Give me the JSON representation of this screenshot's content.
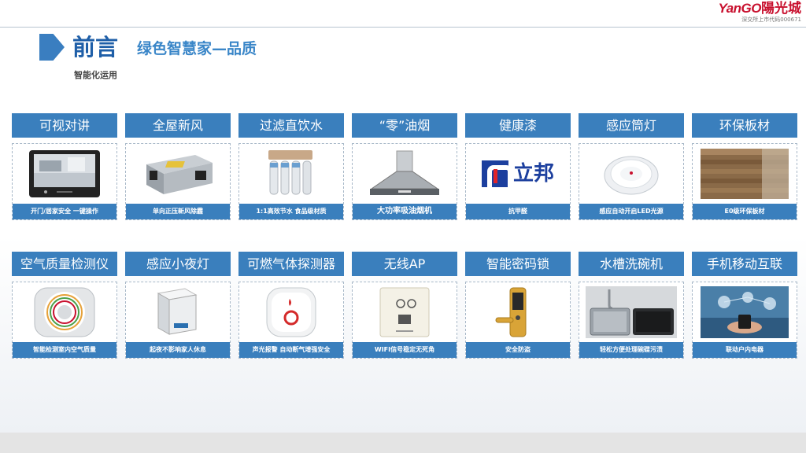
{
  "header": {
    "logo_en": "YanGO",
    "logo_cn": "陽光城",
    "logo_sub": "深交所上市代码000671"
  },
  "title": {
    "main": "前言",
    "sub": "绿色智慧家—品质",
    "section": "智能化运用"
  },
  "colors": {
    "accent": "#3a7fbd",
    "title": "#1f5fa8",
    "brand_red": "#c8102e"
  },
  "row1": [
    {
      "title": "可视对讲",
      "caption": "开门/居家安全  一键操作",
      "icon": "video-intercom-icon"
    },
    {
      "title": "全屋新风",
      "caption": "单向正压新风除霾",
      "icon": "fresh-air-unit-icon"
    },
    {
      "title": "过滤直饮水",
      "caption": "1:1高效节水  食品级材质",
      "icon": "water-filter-icon"
    },
    {
      "title": "“零”油烟",
      "caption": "大功率吸油烟机",
      "icon": "range-hood-icon"
    },
    {
      "title": "健康漆",
      "caption": "抗甲醛",
      "icon": "nippon-logo-icon",
      "brand": "立邦"
    },
    {
      "title": "感应筒灯",
      "caption": "感应自动开启LED光源",
      "icon": "downlight-icon"
    },
    {
      "title": "环保板材",
      "caption": "E0级环保板材",
      "icon": "wood-panel-icon"
    }
  ],
  "row2": [
    {
      "title": "空气质量检测仪",
      "caption": "智能检测室内空气质量",
      "icon": "air-monitor-icon"
    },
    {
      "title": "感应小夜灯",
      "caption": "起夜不影响家人休息",
      "icon": "night-light-icon"
    },
    {
      "title": "可燃气体探测器",
      "caption": "声光报警 自动断气增强安全",
      "icon": "gas-detector-icon"
    },
    {
      "title": "无线AP",
      "caption": "WIFI信号稳定无死角",
      "icon": "wireless-ap-icon"
    },
    {
      "title": "智能密码锁",
      "caption": "安全防盗",
      "icon": "smart-lock-icon"
    },
    {
      "title": "水槽洗碗机",
      "caption": "轻松方便处理碗碟污渍",
      "icon": "sink-dishwasher-icon"
    },
    {
      "title": "手机移动互联",
      "caption": "联动户内电器",
      "icon": "mobile-connect-icon"
    }
  ]
}
